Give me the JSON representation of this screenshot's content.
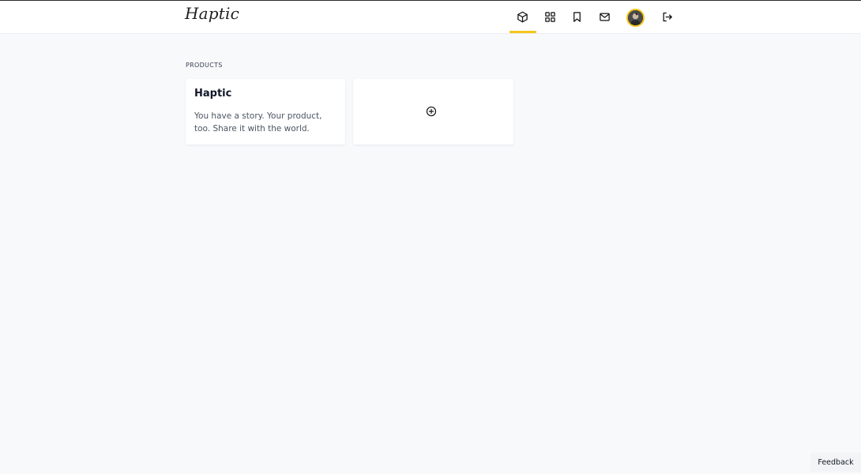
{
  "header": {
    "logo_text": "Haptic",
    "nav": [
      {
        "name": "products",
        "icon": "cube-icon",
        "active": true
      },
      {
        "name": "dashboard",
        "icon": "grid-icon",
        "active": false
      },
      {
        "name": "bookmarks",
        "icon": "bookmark-icon",
        "active": false
      },
      {
        "name": "messages",
        "icon": "mail-icon",
        "active": false
      },
      {
        "name": "profile",
        "icon": "avatar",
        "active": false
      },
      {
        "name": "logout",
        "icon": "logout-icon",
        "active": false
      }
    ],
    "accent_color": "#f5c518"
  },
  "main": {
    "section_label": "PRODUCTS",
    "cards": [
      {
        "title": "Haptic",
        "description": "You have a story. Your product, too. Share it with the world."
      }
    ],
    "add_card_icon": "plus-circle-icon"
  },
  "feedback": {
    "label": "Feedback"
  },
  "colors": {
    "background": "#f8f9fb",
    "card": "#ffffff",
    "accent": "#f5c518",
    "text": "#111827",
    "muted_text": "#4b5563"
  }
}
